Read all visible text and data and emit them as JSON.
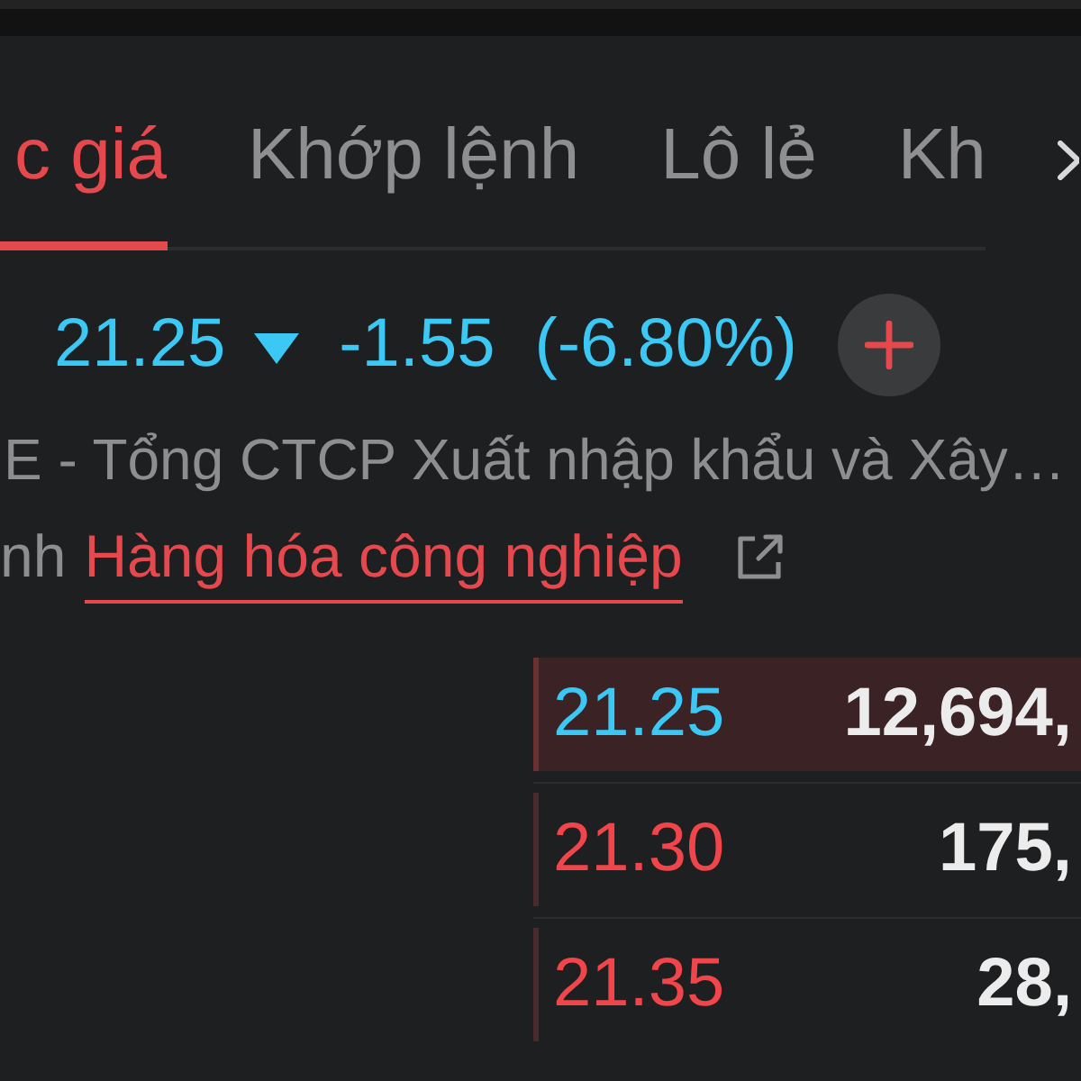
{
  "tabs": [
    {
      "label": "c giá",
      "selected": true
    },
    {
      "label": "Khớp lệnh",
      "selected": false
    },
    {
      "label": "Lô lẻ",
      "selected": false
    },
    {
      "label": "Kh",
      "selected": false
    }
  ],
  "quote": {
    "price": "21.25",
    "change": "-1.55",
    "change_percent": "(-6.80%)"
  },
  "company": {
    "name": "E - Tổng CTCP Xuất nhập khẩu và Xây…"
  },
  "industry": {
    "label": "nh",
    "value": "Hàng hóa công nghiệp"
  },
  "order_book": [
    {
      "price": "21.25",
      "color": "#3cc8f5",
      "volume": "12,694,",
      "highlighted": true
    },
    {
      "price": "21.30",
      "color": "#f0454b",
      "volume": "175,",
      "highlighted": false
    },
    {
      "price": "21.35",
      "color": "#f0454b",
      "volume": "28,",
      "highlighted": false
    }
  ]
}
